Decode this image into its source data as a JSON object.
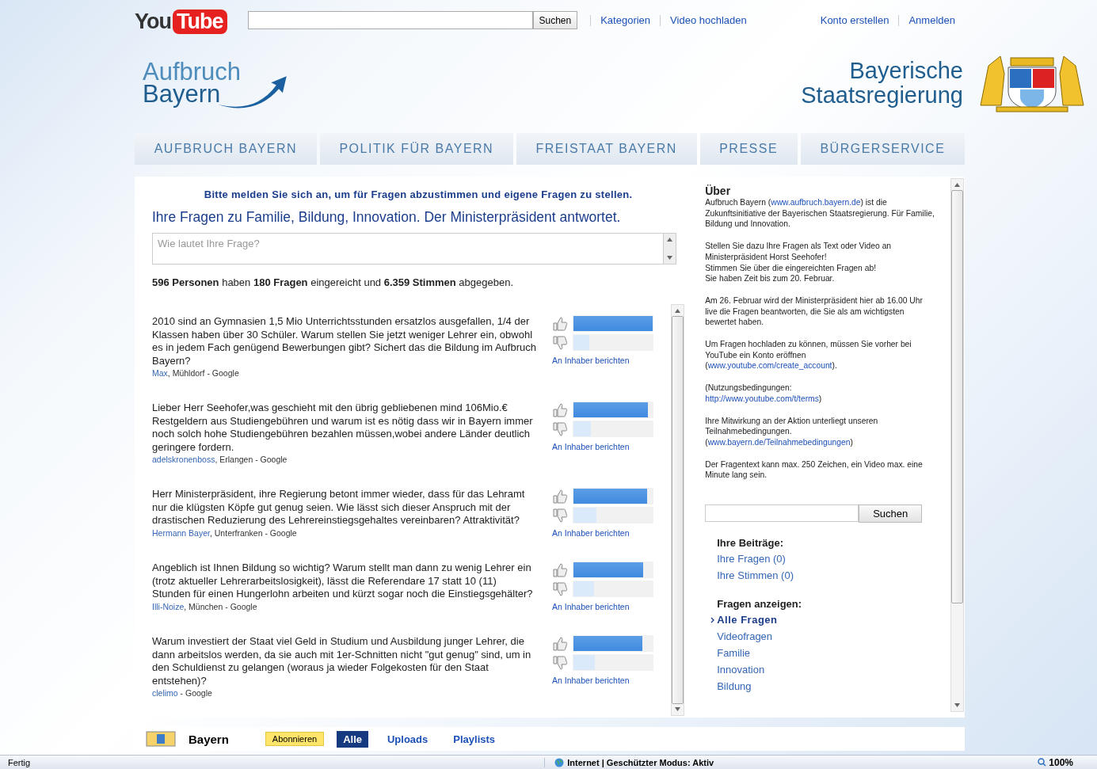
{
  "topbar": {
    "logo": {
      "part1": "You",
      "part2": "Tube"
    },
    "search_button": "Suchen",
    "links_left": [
      "Kategorien",
      "Video hochladen"
    ],
    "links_right": [
      "Konto erstellen",
      "Anmelden"
    ]
  },
  "header": {
    "logo_lines": [
      "Aufbruch",
      "Bayern"
    ],
    "government_lines": [
      "Bayerische",
      "Staatsregierung"
    ]
  },
  "nav": [
    "AUFBRUCH BAYERN",
    "POLITIK FÜR BAYERN",
    "FREISTAAT BAYERN",
    "PRESSE",
    "BÜRGERSERVICE"
  ],
  "main": {
    "login_hint": "Bitte melden Sie sich an, um für Fragen abzustimmen und eigene Fragen zu stellen.",
    "title": "Ihre Fragen zu Familie, Bildung, Innovation. Der Ministerpräsident antwortet.",
    "question_field": {
      "placeholder": "Wie lautet Ihre Frage?"
    },
    "stats": "**596 Personen** haben **180 Fragen** eingereicht und **6.359 Stimmen** abgegeben.",
    "questions": [
      {
        "text": "2010 sind an Gymnasien 1,5 Mio Unterrichtsstunden ersatzlos ausgefallen, 1/4 der Klassen haben über 30 Schüler. Warum stellen Sie jetzt weniger Lehrer ein, obwohl es in jedem Fach genügend Bewerbungen gibt? Sichert das die Bildung im Aufbruch Bayern?",
        "author": "Max",
        "meta": ", Mühldorf - Google",
        "up": {
          "level": 1.0
        },
        "down": {
          "level": 0.2
        },
        "report": "An Inhaber berichten"
      },
      {
        "text": "Lieber Herr Seehofer,was geschieht mit den übrig gebliebenen mind 106Mio.€ Restgeldern aus Studiengebühren und warum ist es nötig dass wir in Bayern immer noch solch hohe Studiengebühren bezahlen müssen,wobei andere Länder deutlich geringere fordern.",
        "author": "adelskronenboss",
        "meta": ", Erlangen - Google",
        "up": {
          "level": 0.94
        },
        "down": {
          "level": 0.22
        },
        "report": "An Inhaber berichten"
      },
      {
        "text": "Herr Ministerpräsident, ihre Regierung betont immer wieder, dass für das Lehramt nur die klügsten Köpfe gut genug seien. Wie lässt sich dieser Anspruch mit der drastischen Reduzierung des Lehrereinstiegsgehaltes vereinbaren? Attraktivität?",
        "author": "Hermann Bayer",
        "meta": ", Unterfranken - Google",
        "up": {
          "level": 0.93
        },
        "down": {
          "level": 0.29
        },
        "report": "An Inhaber berichten"
      },
      {
        "text": "Angeblich ist Ihnen Bildung so wichtig? Warum stellt man dann zu wenig Lehrer ein (trotz aktueller Lehrerarbeitslosigkeit), lässt die Referendare 17 statt 10 (11) Stunden für einen Hungerlohn arbeiten und kürzt sogar noch die Einstiegsgehälter?",
        "author": "Illi-Noize",
        "meta": ", München - Google",
        "up": {
          "level": 0.88
        },
        "down": {
          "level": 0.26
        },
        "report": "An Inhaber berichten"
      },
      {
        "text": "Warum investiert der Staat viel Geld in Studium und Ausbildung junger Lehrer, die dann arbeitslos werden, da sie auch mit 1er-Schnitten nicht \"gut genug\" sind, um in den Schuldienst zu gelangen (woraus ja wieder Folgekosten für den Staat entstehen)?",
        "author": "clelimo",
        "meta": " - Google",
        "up": {
          "level": 0.87
        },
        "down": {
          "level": 0.27
        },
        "report": "An Inhaber berichten"
      }
    ]
  },
  "sidebar": {
    "title": "Über",
    "paragraphs": [
      [
        {
          "kind": "text",
          "text": "Aufbruch Bayern ("
        },
        {
          "kind": "link",
          "text": "www.aufbruch.bayern.de"
        },
        {
          "kind": "text",
          "text": ") ist die Zukunftsinitiative der Bayerischen Staatsregierung. Für Familie, Bildung und Innovation."
        }
      ],
      [
        {
          "kind": "text",
          "text": "Stellen Sie dazu Ihre Fragen als Text oder Video an Ministerpräsident Horst Seehofer!\nStimmen Sie über die eingereichten Fragen ab!\nSie haben Zeit bis zum 20. Februar."
        }
      ],
      [
        {
          "kind": "text",
          "text": "Am 26. Februar wird der Ministerpräsident hier ab 16.00 Uhr live die Fragen beantworten, die Sie als am wichtigsten bewertet haben."
        }
      ],
      [
        {
          "kind": "text",
          "text": "Um Fragen hochladen zu können, müssen Sie vorher bei YouTube ein Konto eröffnen\n("
        },
        {
          "kind": "link",
          "text": "www.youtube.com/create_account"
        },
        {
          "kind": "text",
          "text": ")."
        }
      ],
      [
        {
          "kind": "text",
          "text": "(Nutzungsbedingungen:\n"
        },
        {
          "kind": "link",
          "text": "http://www.youtube.com/t/terms"
        },
        {
          "kind": "text",
          "text": ")"
        }
      ],
      [
        {
          "kind": "text",
          "text": "Ihre Mitwirkung an der Aktion unterliegt unseren Teilnahmebedingungen.\n("
        },
        {
          "kind": "link",
          "text": "www.bayern.de/Teilnahmebedingungen"
        },
        {
          "kind": "text",
          "text": ")"
        }
      ],
      [
        {
          "kind": "text",
          "text": "Der Fragentext kann max. 250 Zeichen, ein Video max. eine Minute lang sein."
        }
      ]
    ],
    "search_button": "Suchen",
    "contributions": {
      "heading": "Ihre Beiträge:",
      "items": [
        "Ihre Fragen (0)",
        "Ihre Stimmen (0)"
      ]
    },
    "filters": {
      "heading": "Fragen anzeigen:",
      "items": [
        {
          "label": "Alle Fragen",
          "selected": true
        },
        {
          "label": "Videofragen",
          "selected": false
        },
        {
          "label": "Familie",
          "selected": false
        },
        {
          "label": "Innovation",
          "selected": false
        },
        {
          "label": "Bildung",
          "selected": false
        }
      ]
    }
  },
  "channel_bar": {
    "name": "Bayern",
    "subscribe": "Abonnieren",
    "tabs": [
      {
        "label": "Alle",
        "selected": true
      },
      {
        "label": "Uploads",
        "selected": false
      },
      {
        "label": "Playlists",
        "selected": false
      }
    ]
  },
  "status_bar": {
    "status": "Fertig",
    "zone": "Internet | Geschützter Modus: Aktiv",
    "zoom": "100%"
  }
}
